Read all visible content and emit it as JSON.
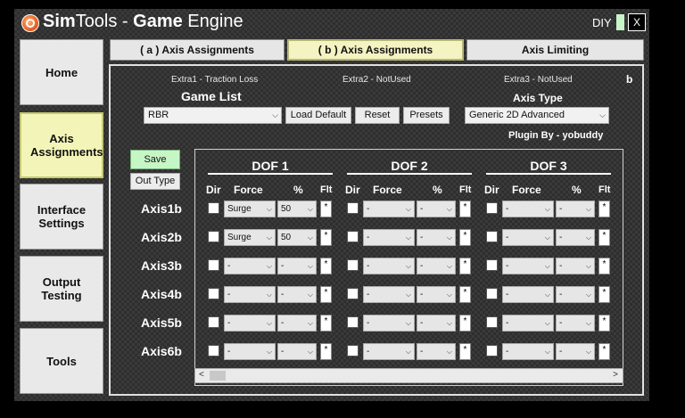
{
  "window": {
    "title_part1": "Sim",
    "title_part2": "Tools - ",
    "title_part3": "Game",
    "title_part4": " Engine",
    "diy_label": "DIY",
    "close_label": "X"
  },
  "nav": [
    {
      "label": "Home",
      "active": false
    },
    {
      "label": "Axis Assignments",
      "active": true
    },
    {
      "label": "Interface Settings",
      "active": false
    },
    {
      "label": "Output Testing",
      "active": false
    },
    {
      "label": "Tools",
      "active": false
    }
  ],
  "tabs": [
    {
      "label": "( a ) Axis Assignments",
      "active": false
    },
    {
      "label": "( b ) Axis Assignments",
      "active": true
    },
    {
      "label": "Axis Limiting",
      "active": false
    }
  ],
  "panel": {
    "extra1": "Extra1 - Traction Loss",
    "extra2": "Extra2 - NotUsed",
    "extra3": "Extra3 - NotUsed",
    "corner": "b",
    "game_list_label": "Game List",
    "game_value": "RBR",
    "load_default": "Load Default",
    "reset": "Reset",
    "presets": "Presets",
    "axis_type_label": "Axis Type",
    "axis_type_value": "Generic 2D Advanced",
    "plugin_by": "Plugin By - yobuddy",
    "save": "Save",
    "out_type": "Out Type"
  },
  "dof_headers": [
    "DOF 1",
    "DOF 2",
    "DOF 3"
  ],
  "col_headers": {
    "dir": "Dir",
    "force": "Force",
    "pct": "%",
    "flt": "Flt"
  },
  "flt_symbol": "*",
  "axes": [
    {
      "name": "Axis1b",
      "dofs": [
        {
          "force": "Surge",
          "pct": "50"
        },
        {
          "force": "-",
          "pct": "-"
        },
        {
          "force": "-",
          "pct": "-"
        }
      ]
    },
    {
      "name": "Axis2b",
      "dofs": [
        {
          "force": "Surge",
          "pct": "50"
        },
        {
          "force": "-",
          "pct": "-"
        },
        {
          "force": "-",
          "pct": "-"
        }
      ]
    },
    {
      "name": "Axis3b",
      "dofs": [
        {
          "force": "-",
          "pct": "-"
        },
        {
          "force": "-",
          "pct": "-"
        },
        {
          "force": "-",
          "pct": "-"
        }
      ]
    },
    {
      "name": "Axis4b",
      "dofs": [
        {
          "force": "-",
          "pct": "-"
        },
        {
          "force": "-",
          "pct": "-"
        },
        {
          "force": "-",
          "pct": "-"
        }
      ]
    },
    {
      "name": "Axis5b",
      "dofs": [
        {
          "force": "-",
          "pct": "-"
        },
        {
          "force": "-",
          "pct": "-"
        },
        {
          "force": "-",
          "pct": "-"
        }
      ]
    },
    {
      "name": "Axis6b",
      "dofs": [
        {
          "force": "-",
          "pct": "-"
        },
        {
          "force": "-",
          "pct": "-"
        },
        {
          "force": "-",
          "pct": "-"
        }
      ]
    }
  ],
  "scroll": {
    "left_arrow": "<",
    "right_arrow": ">"
  }
}
